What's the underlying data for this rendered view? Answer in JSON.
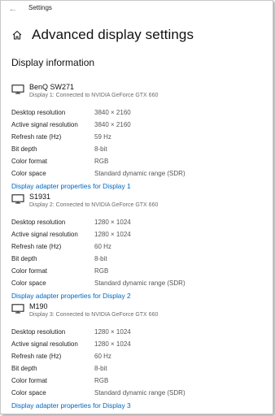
{
  "window": {
    "title": "Settings",
    "back_icon": "back-arrow-icon"
  },
  "page": {
    "title": "Advanced display settings",
    "home_icon": "home-icon"
  },
  "section": {
    "title": "Display information"
  },
  "labels": {
    "desktop_resolution": "Desktop resolution",
    "active_signal_resolution": "Active signal resolution",
    "refresh_rate": "Refresh rate (Hz)",
    "bit_depth": "Bit depth",
    "color_format": "Color format",
    "color_space": "Color space"
  },
  "displays": [
    {
      "name": "BenQ SW271",
      "subtitle": "Display 1: Connected to NVIDIA GeForce GTX 660",
      "desktop_resolution": "3840 × 2160",
      "active_signal_resolution": "3840 × 2160",
      "refresh_rate": "59 Hz",
      "bit_depth": "8-bit",
      "color_format": "RGB",
      "color_space": "Standard dynamic range (SDR)",
      "link": "Display adapter properties for Display 1"
    },
    {
      "name": "S1931",
      "subtitle": "Display 2: Connected to NVIDIA GeForce GTX 660",
      "desktop_resolution": "1280 × 1024",
      "active_signal_resolution": "1280 × 1024",
      "refresh_rate": "60 Hz",
      "bit_depth": "8-bit",
      "color_format": "RGB",
      "color_space": "Standard dynamic range (SDR)",
      "link": "Display adapter properties for Display 2"
    },
    {
      "name": "M190",
      "subtitle": "Display 3: Connected to NVIDIA GeForce GTX 660",
      "desktop_resolution": "1280 × 1024",
      "active_signal_resolution": "1280 × 1024",
      "refresh_rate": "60 Hz",
      "bit_depth": "8-bit",
      "color_format": "RGB",
      "color_space": "Standard dynamic range (SDR)",
      "link": "Display adapter properties for Display 3"
    }
  ],
  "colors": {
    "link": "#0067c0",
    "muted": "#6b6b6b"
  }
}
